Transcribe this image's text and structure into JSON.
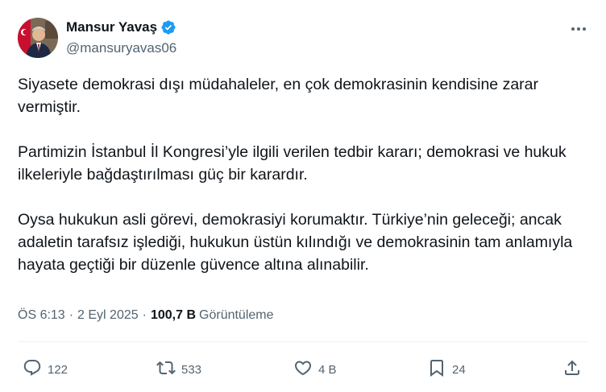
{
  "author": {
    "name": "Mansur Yavaş",
    "handle": "@mansuryavas06",
    "verified": true
  },
  "tweet": {
    "paragraphs": [
      "Siyasete demokrasi dışı müdahaleler, en çok demokrasinin kendisine zarar vermiştir.",
      "Partimizin İstanbul İl Kongresi’yle ilgili verilen tedbir kararı; demokrasi ve hukuk ilkeleriyle bağdaştırılması güç bir karardır.",
      "Oysa hukukun asli görevi, demokrasiyi korumaktır. Türkiye’nin geleceği; ancak adaletin tarafsız işlediği, hukukun üstün kılındığı ve demokrasinin tam anlamıyla hayata geçtiği bir düzenle güvence altına alınabilir."
    ],
    "time": "ÖS 6:13",
    "separator": "·",
    "date": "2 Eyl 2025",
    "views_count": "100,7 B",
    "views_label": "Görüntüleme"
  },
  "actions": {
    "reply_count": "122",
    "retweet_count": "533",
    "like_count": "4 B",
    "bookmark_count": "24"
  },
  "icons": [
    "verified-badge-icon",
    "more-icon",
    "reply-icon",
    "retweet-icon",
    "like-icon",
    "bookmark-icon",
    "share-icon"
  ],
  "colors": {
    "verified": "#1d9bf0",
    "text": "#0f1419",
    "secondary": "#536471"
  }
}
